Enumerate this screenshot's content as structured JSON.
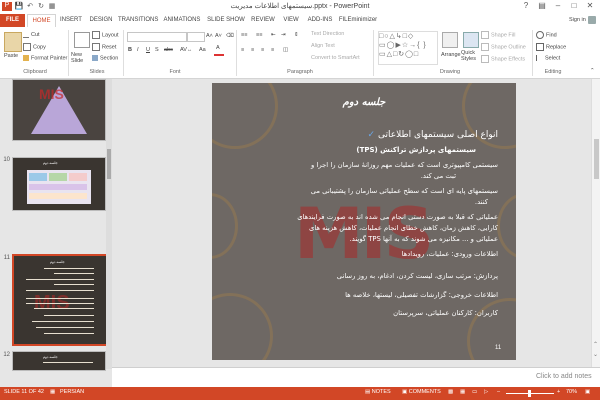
{
  "window": {
    "title": "سیستمهای اطلاعات مدیریت.pptx - PowerPoint",
    "help": "?",
    "sign_in": "Sign in"
  },
  "tabs": [
    "FILE",
    "HOME",
    "INSERT",
    "DESIGN",
    "TRANSITIONS",
    "ANIMATIONS",
    "SLIDE SHOW",
    "REVIEW",
    "VIEW",
    "ADD-INS",
    "FILEminimizer"
  ],
  "ribbon": {
    "clipboard": {
      "paste": "Paste",
      "cut": "Cut",
      "copy": "Copy",
      "format_painter": "Format Painter",
      "label": "Clipboard"
    },
    "slides": {
      "new_slide": "New Slide",
      "layout": "Layout",
      "reset": "Reset",
      "section": "Section",
      "label": "Slides"
    },
    "font": {
      "label": "Font",
      "bold": "B",
      "italic": "I",
      "underline": "U",
      "strike": "S",
      "abc": "abc",
      "aa": "Aa"
    },
    "paragraph": {
      "text_direction": "Text Direction",
      "align_text": "Align Text",
      "convert_smartart": "Convert to SmartArt",
      "label": "Paragraph"
    },
    "drawing": {
      "arrange": "Arrange",
      "quick_styles": "Quick Styles",
      "shape_fill": "Shape Fill",
      "shape_outline": "Shape Outline",
      "shape_effects": "Shape Effects",
      "label": "Drawing"
    },
    "editing": {
      "find": "Find",
      "replace": "Replace",
      "select": "Select",
      "label": "Editing"
    }
  },
  "thumbnails": [
    {
      "num": "",
      "title": ""
    },
    {
      "num": "10",
      "title": "جلسه دوم"
    },
    {
      "num": "11",
      "title": "جلسه دوم"
    },
    {
      "num": "12",
      "title": "جلسه دوم"
    }
  ],
  "slide": {
    "session_title": "جلسه دوم",
    "heading": "انواع اصلی سیستمهای اطلاعاتی",
    "sub_heading": "سیستمهای پردازش تراکنش (TPS)",
    "watermark": "MIS",
    "lines": [
      "سیستمی کامپیوتری است که عملیات مهم روزانهٔ سازمان را اجرا و",
      "ثبت می کند.",
      "سیستمهای پایه ای است که سطح عملیاتی سازمان را پشتیبانی می",
      "کنند.",
      "عملیاتی که قبلا به صورت دستی انجام می شده اند به صورت فرایندهای",
      "کارایی، کاهش زمان، کاهش خطای انجام عملیات، کاهش هزینه های",
      "عملیاتی و ... مکانیزه می شوند که به آنها TPS گویند.",
      "اطلاعات ورودی: عملیات، رویدادها",
      "پردازش: مرتب سازی، لیست کردن، ادغام، به روز رسانی",
      "اطلاعات خروجی: گزارشات تفصیلی، لیستها، خلاصه ها",
      "کاربران: کارکنان عملیاتی، سرپرستان"
    ],
    "slide_number": "11"
  },
  "notes": {
    "placeholder": "Click to add notes"
  },
  "status": {
    "slide_of": "SLIDE 11 OF 42",
    "language": "PERSIAN",
    "notes": "NOTES",
    "comments": "COMMENTS",
    "zoom": "70%"
  },
  "colors": {
    "accent": "#d24726"
  }
}
